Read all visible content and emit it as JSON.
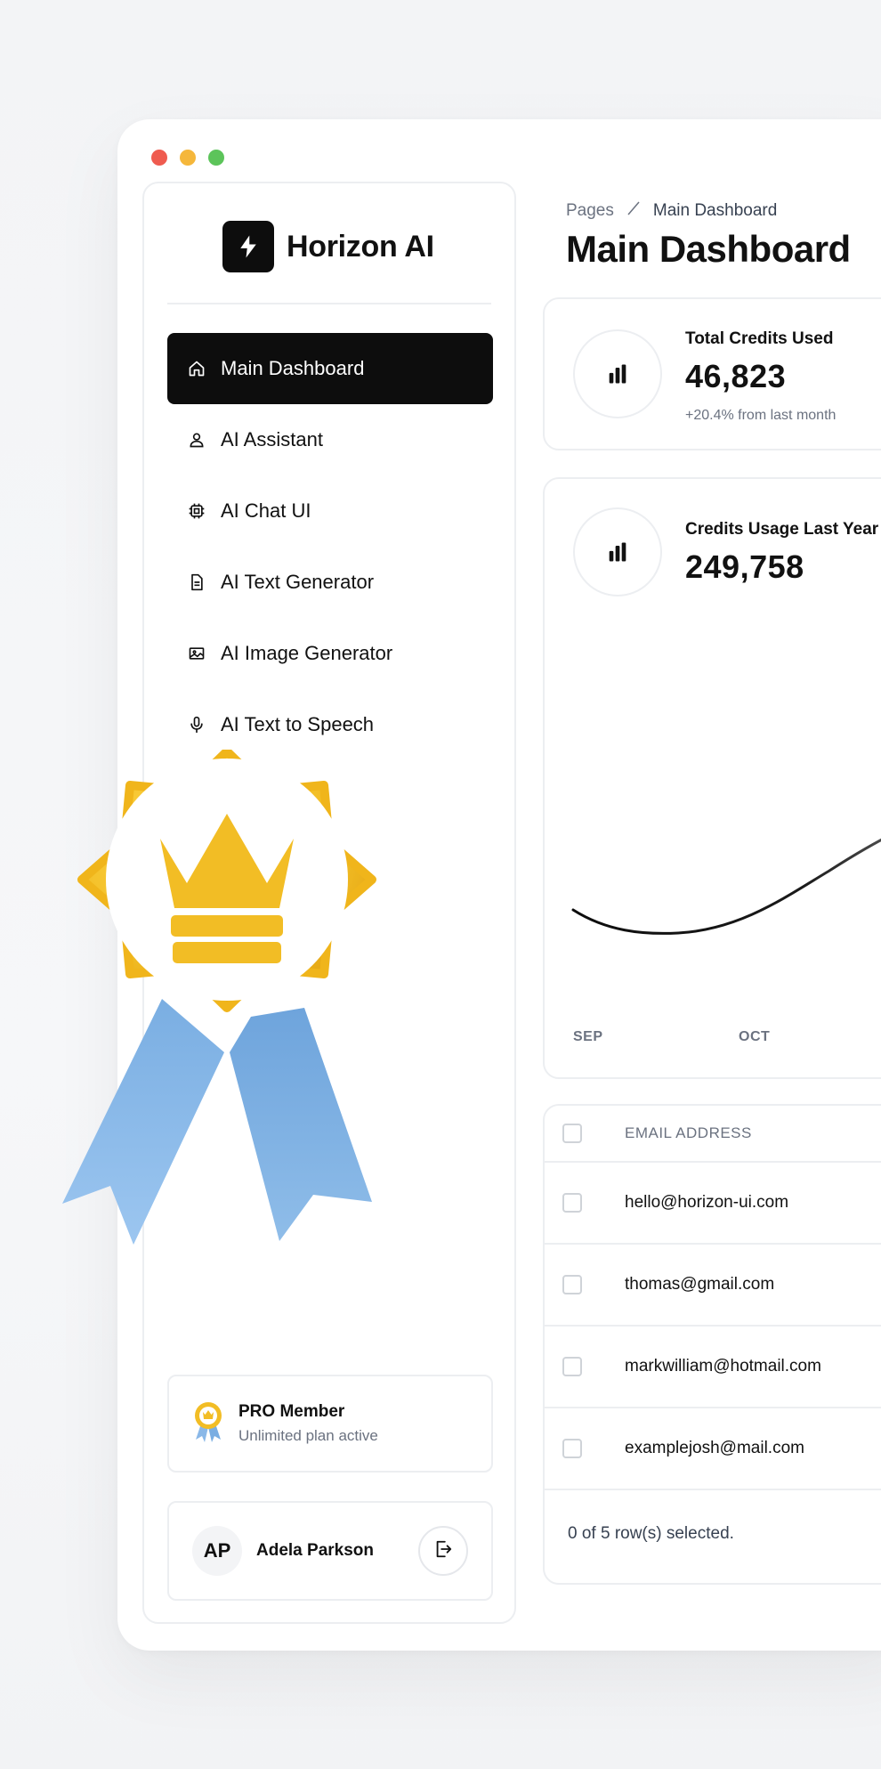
{
  "brand": {
    "name": "Horizon AI"
  },
  "sidebar": {
    "items": [
      {
        "label": "Main Dashboard",
        "icon": "home-icon",
        "active": true
      },
      {
        "label": "AI Assistant",
        "icon": "user-icon",
        "active": false
      },
      {
        "label": "AI Chat UI",
        "icon": "chip-icon",
        "active": false
      },
      {
        "label": "AI Text Generator",
        "icon": "document-icon",
        "active": false
      },
      {
        "label": "AI Image Generator",
        "icon": "image-icon",
        "active": false
      },
      {
        "label": "AI Text to Speech",
        "icon": "microphone-icon",
        "active": false
      }
    ],
    "pro": {
      "title": "PRO Member",
      "subtitle": "Unlimited plan active"
    },
    "user": {
      "initials": "AP",
      "name": "Adela Parkson"
    }
  },
  "header": {
    "breadcrumb_root": "Pages",
    "breadcrumb_current": "Main Dashboard",
    "title": "Main Dashboard"
  },
  "stats": {
    "credits_used": {
      "label": "Total Credits Used",
      "value": "46,823",
      "delta": "+20.4% from last month"
    },
    "usage_last_year": {
      "label": "Credits Usage Last Year",
      "value": "249,758"
    }
  },
  "chart_data": {
    "type": "line",
    "x": [
      "SEP",
      "OCT"
    ],
    "title": "Credits Usage Last Year",
    "series": [
      {
        "values": []
      }
    ]
  },
  "table": {
    "column_email": "EMAIL ADDRESS",
    "rows": [
      {
        "email": "hello@horizon-ui.com"
      },
      {
        "email": "thomas@gmail.com"
      },
      {
        "email": "markwilliam@hotmail.com"
      },
      {
        "email": "examplejosh@mail.com"
      }
    ],
    "footer": "0 of 5 row(s) selected."
  },
  "colors": {
    "accent": "#0d0d0d",
    "badge_gold": "#f2bd25",
    "ribbon_blue": "#8ab8e8",
    "window_red": "#ef5b4f",
    "window_yellow": "#f5b73b",
    "window_green": "#5cc45a"
  }
}
